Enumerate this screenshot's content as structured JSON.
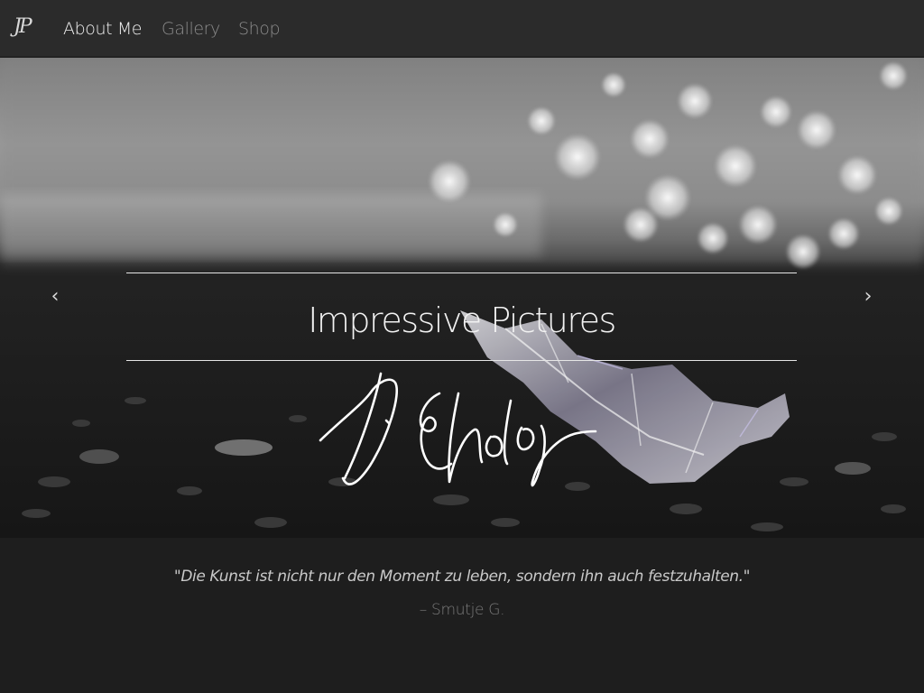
{
  "navbar": {
    "brand": "JP",
    "links": [
      {
        "label": "About Me",
        "active": true
      },
      {
        "label": "Gallery",
        "active": false
      },
      {
        "label": "Shop",
        "active": false
      }
    ]
  },
  "hero": {
    "caption_title": "Impressive Pictures",
    "signature": "D. Scholz",
    "prev_icon": "chevron-left-icon",
    "next_icon": "chevron-right-icon"
  },
  "quote": {
    "text": "\"Die Kunst ist nicht nur den Moment zu leben, sondern ihn auch festzuhalten.\"",
    "author": "– Smutje G."
  },
  "colors": {
    "navbar_bg": "#2b2b2b",
    "page_bg": "#1e1e1e",
    "active_link": "#f0f0f0",
    "inactive_link": "#8c8c8c"
  }
}
